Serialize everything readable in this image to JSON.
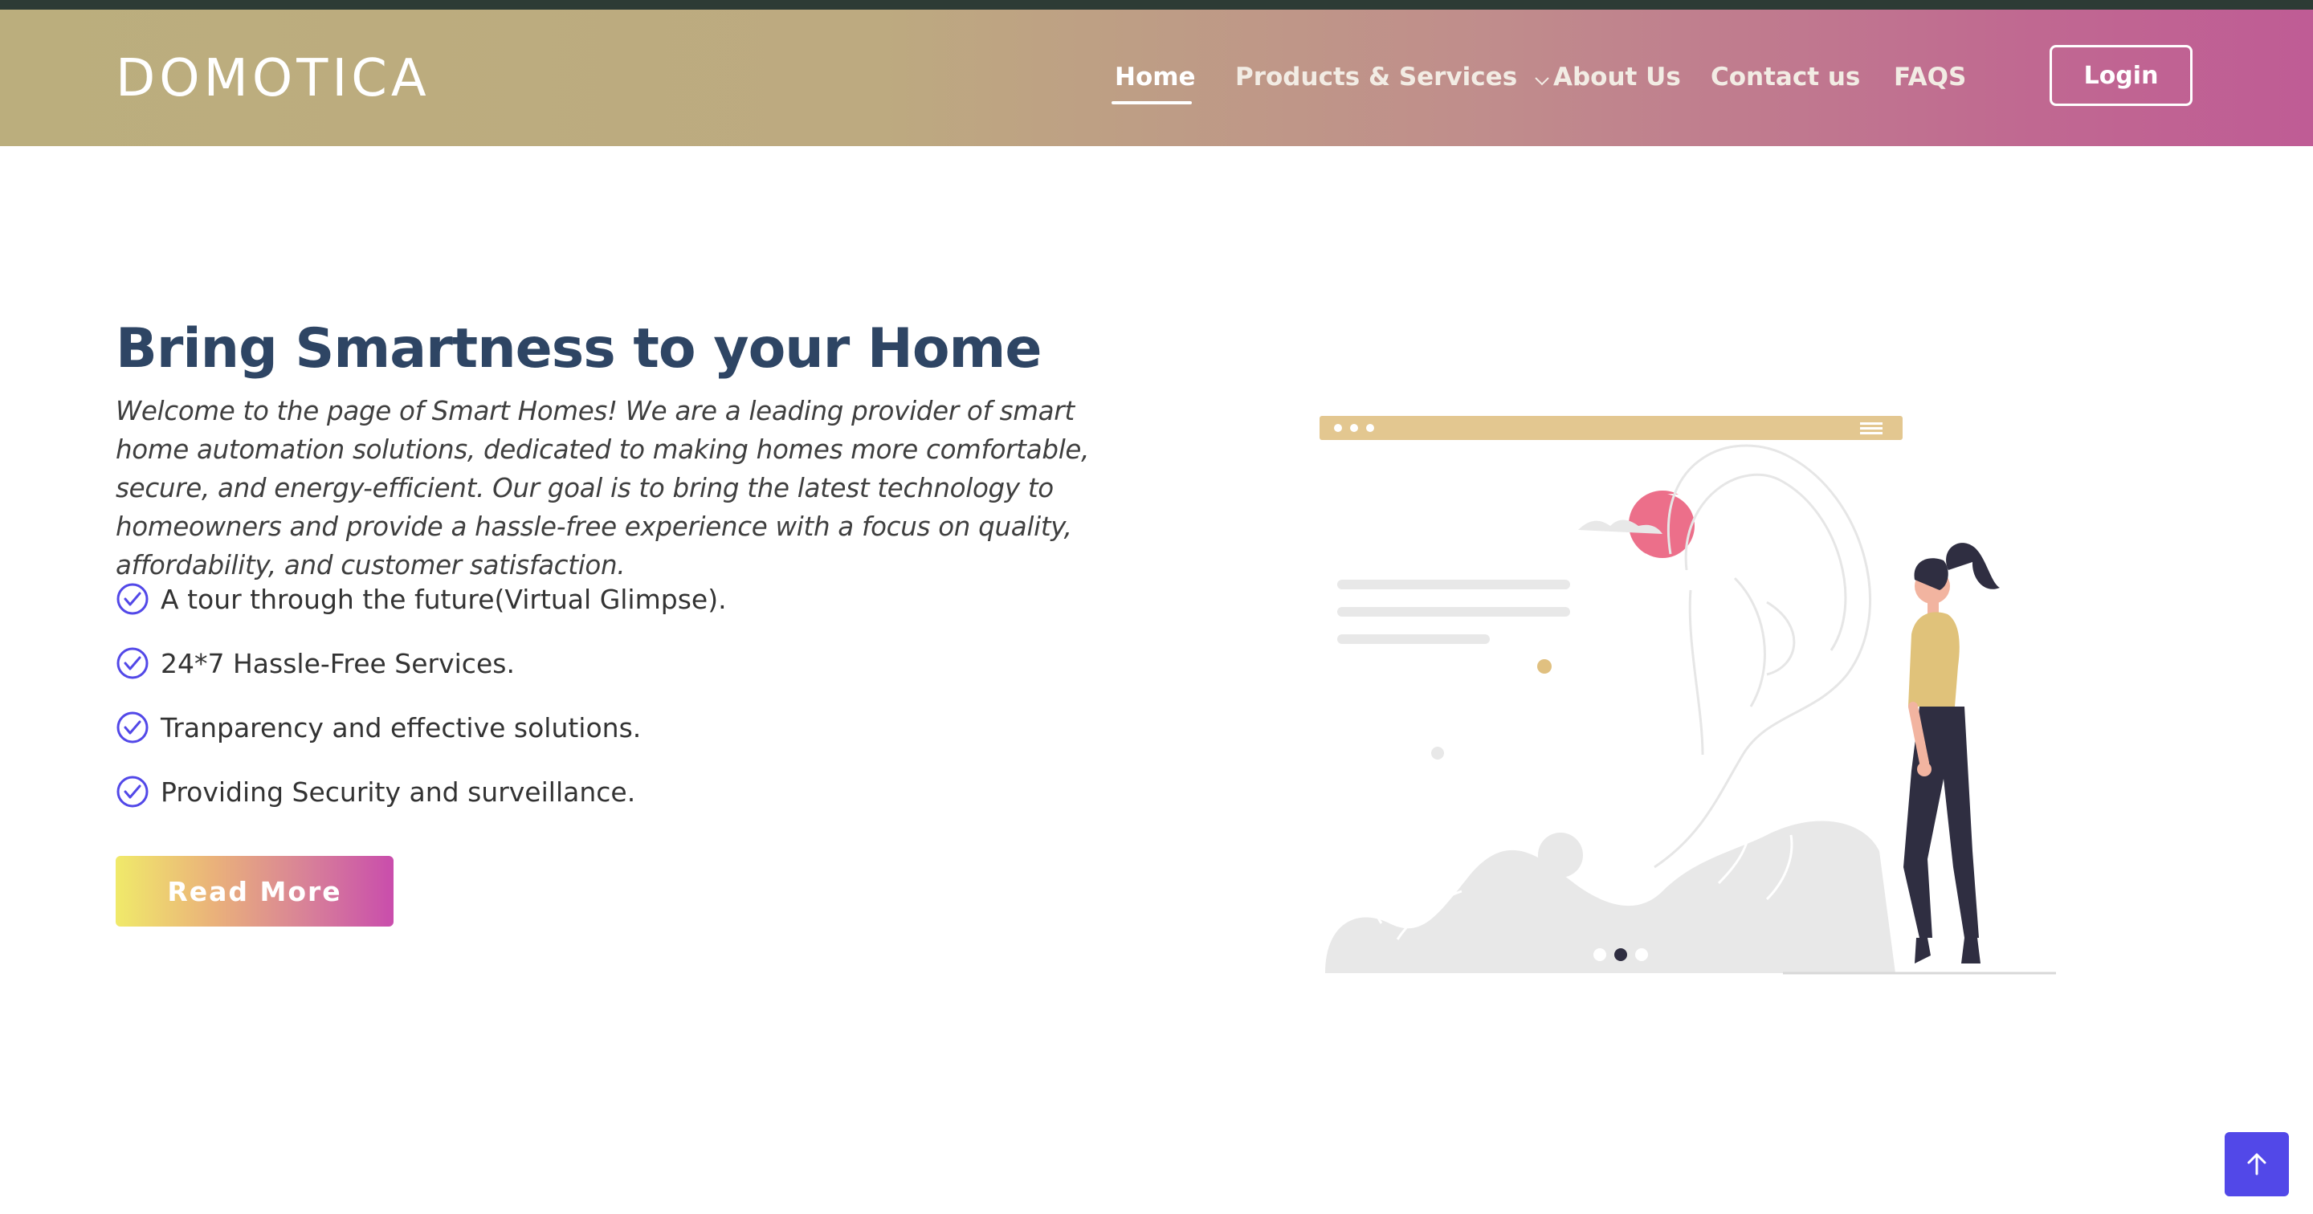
{
  "header": {
    "logo": "DOMOTICA",
    "nav": [
      {
        "label": "Home",
        "active": true
      },
      {
        "label": "Products & Services",
        "has_dropdown": true
      },
      {
        "label": "About Us"
      },
      {
        "label": "Contact us"
      },
      {
        "label": "FAQS"
      }
    ],
    "login_label": "Login"
  },
  "hero": {
    "title": "Bring Smartness to your Home",
    "description": "Welcome to the page of Smart Homes! We are a leading provider of smart home automation solutions, dedicated to making homes more comfortable, secure, and energy-efficient. Our goal is to bring the latest technology to homeowners and provide a hassle-free experience with a focus on quality, affordability, and customer satisfaction.",
    "features": [
      "A tour through the future(Virtual Glimpse).",
      "24*7 Hassle-Free Services.",
      "Tranparency and effective solutions.",
      "Providing Security and surveillance."
    ],
    "cta_label": "Read More"
  },
  "colors": {
    "accent": "#5248e8",
    "title": "#2e4564",
    "header_gradient_start": "#bbae7d",
    "header_gradient_end": "#bf5c95"
  },
  "icons": {
    "feature": "check-circle-icon",
    "scroll_top": "arrow-up-icon",
    "dropdown": "chevron-down-icon"
  }
}
